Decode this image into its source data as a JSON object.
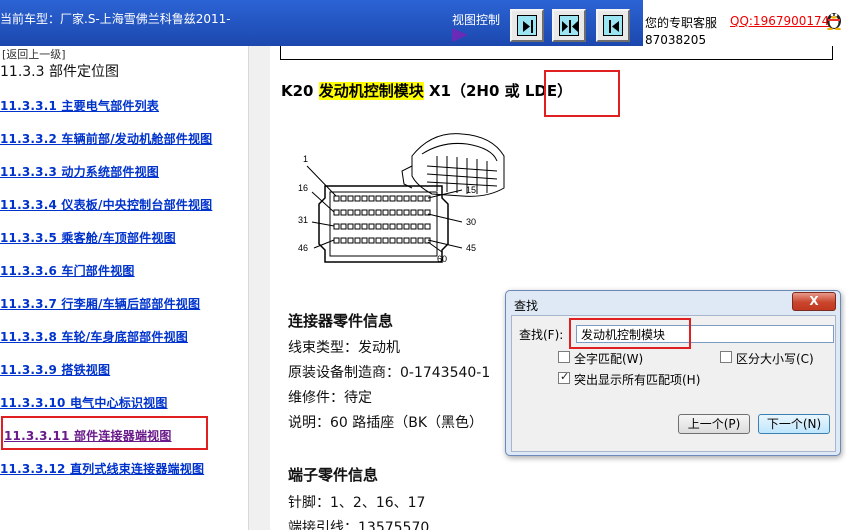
{
  "header": {
    "car_model": "当前车型：厂家.S-上海雪佛兰科鲁兹2011-",
    "view_control_label": "视图控制",
    "support_label": "您的专职客服",
    "support_qq": "QQ:1967900174",
    "support_qq_tail": "87038205"
  },
  "nav": {
    "back_link": "[返回上一级]",
    "section_title": "11.3.3 部件定位图",
    "items": [
      {
        "label": "11.3.3.1  主要电气部件列表"
      },
      {
        "label": "11.3.3.2  车辆前部/发动机舱部件视图"
      },
      {
        "label": "11.3.3.3  动力系统部件视图"
      },
      {
        "label": "11.3.3.4  仪表板/中央控制台部件视图"
      },
      {
        "label": "11.3.3.5  乘客舱/车顶部件视图"
      },
      {
        "label": "11.3.3.6  车门部件视图"
      },
      {
        "label": "11.3.3.7  行李厢/车辆后部部件视图"
      },
      {
        "label": "11.3.3.8  车轮/车身底部部件视图"
      },
      {
        "label": "11.3.3.9  搭铁视图"
      },
      {
        "label": "11.3.3.10  电气中心标识视图"
      },
      {
        "label": "11.3.3.11  部件连接器端视图"
      },
      {
        "label": "11.3.3.12  直列式线束连接器端视图"
      }
    ]
  },
  "content": {
    "heading_prefix": "K20 ",
    "heading_highlight": "发动机控制模块",
    "heading_mid": " X1（2H0 或 ",
    "heading_tail": "LDE）",
    "pin_labels": {
      "p1": "1",
      "p16": "16",
      "p31": "31",
      "p46": "46",
      "p15": "15",
      "p30": "30",
      "p45": "45",
      "p60": "60"
    },
    "connector_info_title": "连接器零件信息",
    "harness_type": "线束类型：发动机",
    "oem_connector": "原装设备制造商：0-1743540-1",
    "service_part": "维修件：待定",
    "description": "说明：60 路插座（BK（黑色）",
    "terminal_info_title": "端子零件信息",
    "pins": "针脚：1、2、16、17",
    "terminal_lead": "端接引线：13575570"
  },
  "find_dialog": {
    "title": "查找",
    "close_label": "X",
    "find_label": "查找(F):",
    "find_value": "发动机控制模块",
    "whole_word_label": "全字匹配(W)",
    "whole_word_checked": false,
    "match_case_label": "区分大小写(C)",
    "match_case_checked": false,
    "highlight_all_label": "突出显示所有匹配项(H)",
    "highlight_all_checked": true,
    "prev_button": "上一个(P)",
    "next_button": "下一个(N)"
  },
  "colors": {
    "header_bg": "#1c48ae",
    "link": "#0033cc",
    "visited_link": "#6a1a8a",
    "annotation_red": "#e02020",
    "highlight": "#ffff00"
  }
}
